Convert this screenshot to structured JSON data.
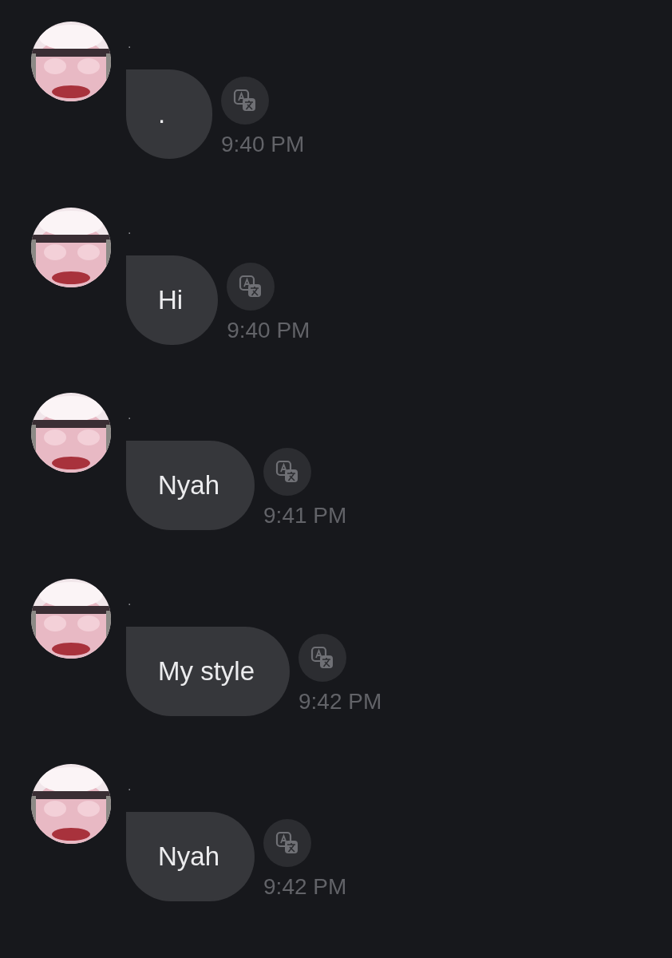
{
  "messages": [
    {
      "sender": ".",
      "text": ".",
      "time": "9:40 PM"
    },
    {
      "sender": ".",
      "text": "Hi",
      "time": "9:40 PM"
    },
    {
      "sender": ".",
      "text": "Nyah",
      "time": "9:41 PM"
    },
    {
      "sender": ".",
      "text": "My style",
      "time": "9:42 PM"
    },
    {
      "sender": ".",
      "text": "Nyah",
      "time": "9:42 PM"
    }
  ]
}
